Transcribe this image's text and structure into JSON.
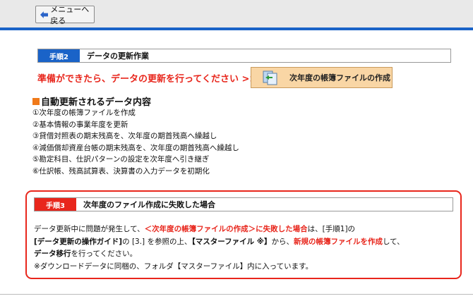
{
  "nav": {
    "back_label": "メニューへ戻る"
  },
  "step2": {
    "badge": "手順2",
    "title": "データの更新作業",
    "cta_text": "準備ができたら、データの更新を行ってください >>",
    "cta_button": "次年度の帳簿ファイルの作成"
  },
  "auto_update": {
    "heading": "自動更新されるデータ内容",
    "items": [
      "①次年度の帳簿ファイルを作成",
      "②基本情報の事業年度を更新",
      "③貸借対照表の期末残高を、次年度の期首残高へ繰越し",
      "④減価償却資産台帳の期末残高を、次年度の期首残高へ繰越し",
      "⑤勘定科目、仕訳パターンの設定を次年度へ引き継ぎ",
      "⑥仕訳帳、残高試算表、決算書の入力データを初期化"
    ]
  },
  "step3": {
    "badge": "手順3",
    "title": "次年度のファイル作成に失敗した場合",
    "l1_a": "データ更新中に問題が発生して、",
    "l1_b": "＜次年度の帳簿ファイルの作成＞に失敗した場合",
    "l1_c": "は、[手順1]の",
    "l2_a": "[データ更新の操作ガイド]",
    "l2_b": "の [3.] を参照の上、",
    "l2_c": "【マスターファイル ※】",
    "l2_d": "から、",
    "l2_e": "新規の帳簿ファイルを作成",
    "l2_f": "して、",
    "l3_a": "データ移行",
    "l3_b": "を行ってください。",
    "note": "※ダウンロードデータに同梱の、フォルダ【マスターファイル】内に入っています。"
  }
}
